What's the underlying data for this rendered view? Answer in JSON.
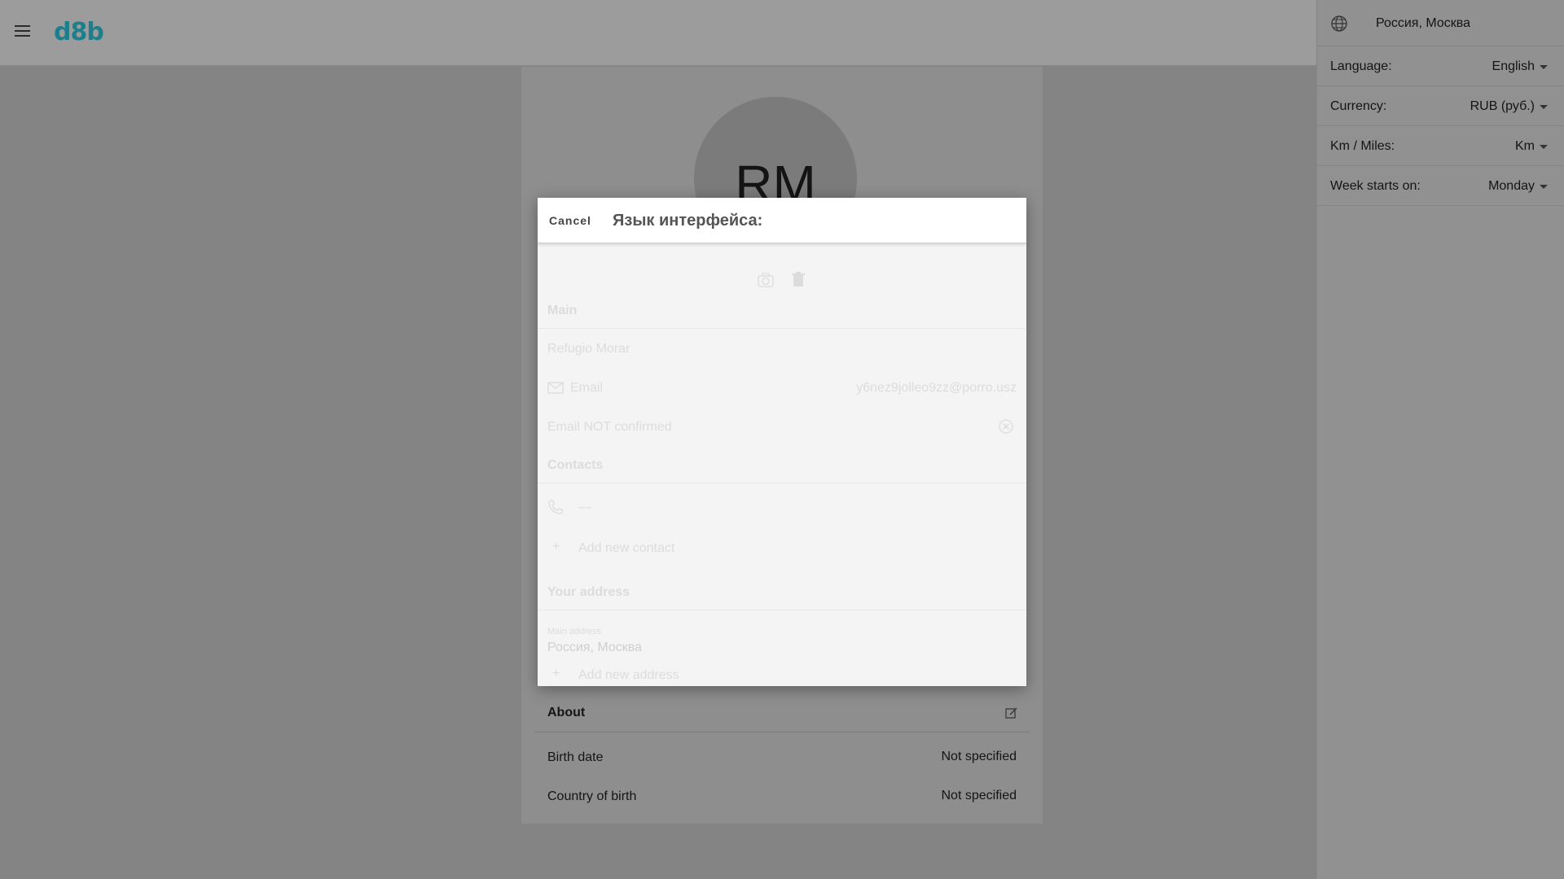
{
  "app": {
    "logo": "d8b"
  },
  "profile": {
    "initials": "RM",
    "about": {
      "title": "About",
      "rows": [
        {
          "label": "Birth date",
          "value": "Not specified"
        },
        {
          "label": "Country of birth",
          "value": "Not specified"
        }
      ]
    }
  },
  "settings_panel": {
    "location": "Россия, Москва",
    "rows": [
      {
        "label": "Language:",
        "value": "English"
      },
      {
        "label": "Currency:",
        "value": "RUB (руб.)"
      },
      {
        "label": "Km / Miles:",
        "value": "Km"
      },
      {
        "label": "Week starts on:",
        "value": "Monday"
      }
    ]
  },
  "modal": {
    "cancel_label": "Cancel",
    "title": "Язык интерфейса:"
  },
  "ghost": {
    "main": "Main",
    "name": "Refugio Morar",
    "email_label": "Email",
    "email_value": "y6nez9jolleo9zz@porro.usz",
    "email_status": "Email NOT confirmed",
    "contacts": "Contacts",
    "phone": "—",
    "add_contact": "Add new contact",
    "your_address": "Your address",
    "main_address_label": "Main address",
    "address_value": "Россия, Москва",
    "add_address": "Add new address"
  },
  "colors": {
    "brand": "#1e7f8c",
    "overlay": "#848484",
    "modal_bg": "#f4f4f4"
  }
}
